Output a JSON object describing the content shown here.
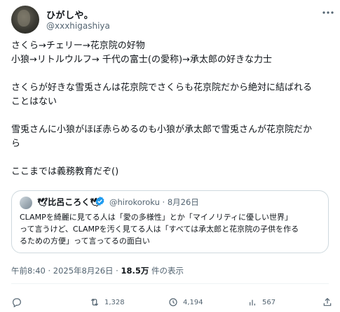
{
  "author": {
    "display_name": "ひがしや。",
    "handle": "@xxxhigashiya"
  },
  "post": {
    "lines": [
      "さくら→チェリー→花京院の好物",
      "小狼→リトルウルフ→ 千代の富士(の愛称)→承太郎の好きな力士",
      "",
      "さくらが好きな雪兎さんは花京院でさくらも花京院だから絶対に結ばれる",
      "ことはない",
      "",
      "雪兎さんに小狼がほぼ赤らめるのも小狼が承太郎で雪兎さんが花京院だか",
      "ら",
      "",
      "ここまでは義務教育だぞ()"
    ]
  },
  "quote": {
    "display_name": "🕊比呂ころく🕊",
    "handle_date": "@hirokoroku · 8月26日",
    "lines": [
      "CLAMPを綺麗に見てる人は「愛の多様性」とか「マイノリティに優しい世界」",
      "って言うけど、CLAMPを汚く見てる人は「すべては承太郎と花京院の子供を作る",
      "るための方便」って言ってるの面白い"
    ]
  },
  "meta": {
    "timestamp": "午前8:40 · 2025年8月26日 · ",
    "views": "18.5万",
    "views_label": " 件の表示"
  },
  "actions": {
    "retweets": "1,328",
    "likes": "4,194",
    "bookmarks": "567"
  },
  "icons": [
    "more-icon",
    "verified-icon",
    "reply-icon",
    "retweet-icon",
    "like-icon",
    "bookmark-icon",
    "share-icon"
  ],
  "colors": {
    "text": "#0f1419",
    "secondary": "#536471",
    "verified": "#1d9bf0",
    "border": "#cfd9de"
  }
}
